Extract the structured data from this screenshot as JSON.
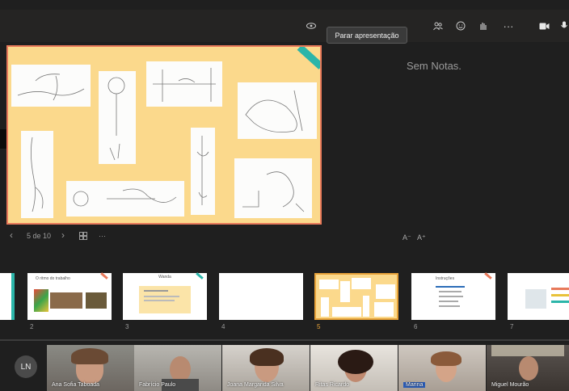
{
  "toolbar": {
    "stop_presenting_label": "Parar apresentação",
    "icons": [
      "eye-icon",
      "people-icon",
      "reactions-icon",
      "raise-hand-icon",
      "more-icon",
      "camera-icon",
      "mic-icon"
    ],
    "more_label": "···"
  },
  "notes": {
    "text": "Sem Notas."
  },
  "slide_controls": {
    "prev": "‹",
    "counter": "5 de 10",
    "next": "›",
    "more": "···",
    "font_decrease": "A⁻",
    "font_increase": "A⁺"
  },
  "thumbnails": [
    {
      "number": "1",
      "title": ""
    },
    {
      "number": "2",
      "title": "O ritmo do trabalho"
    },
    {
      "number": "3",
      "title": "Wanda"
    },
    {
      "number": "4",
      "title": ""
    },
    {
      "number": "5",
      "title": ""
    },
    {
      "number": "6",
      "title": "Instruções"
    },
    {
      "number": "7",
      "title": ""
    }
  ],
  "participants": {
    "self_initials": "LN",
    "tiles": [
      {
        "name": "Ana Sofia Taboada"
      },
      {
        "name": "Fabrício Paulo"
      },
      {
        "name": "Joana Margarida Silva"
      },
      {
        "name": "Ritas Ricardo"
      },
      {
        "name": "Marina"
      },
      {
        "name": "Miguel Mourão"
      }
    ]
  },
  "colors": {
    "background": "#1f1f1f",
    "slide_fill": "#fbd98c",
    "slide_border": "#e8795a",
    "current_thumb_border": "#e8a33a",
    "tape": "#2bb5a9"
  }
}
